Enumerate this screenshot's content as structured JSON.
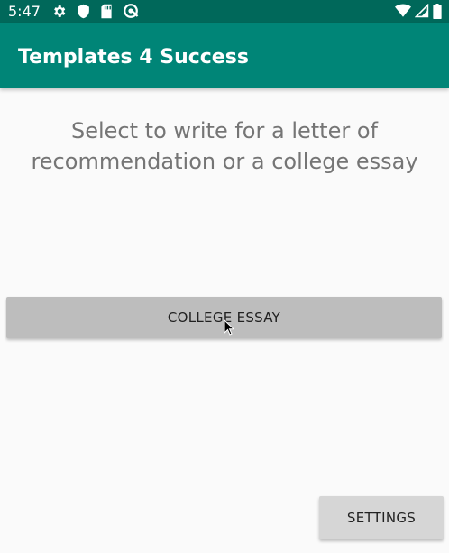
{
  "status_bar": {
    "time": "5:47",
    "left_icons": [
      "gear-icon",
      "shield-icon",
      "sd-card-icon",
      "sync-icon"
    ],
    "right_icons": [
      "wifi-icon",
      "signal-icon",
      "battery-icon"
    ],
    "color": "#00685a"
  },
  "app_bar": {
    "title": "Templates 4 Success",
    "color": "#008577"
  },
  "main": {
    "prompt": "Select to write for a letter of recommendation or a college essay",
    "essay_button_label": "COLLEGE ESSAY",
    "settings_button_label": "SETTINGS"
  }
}
